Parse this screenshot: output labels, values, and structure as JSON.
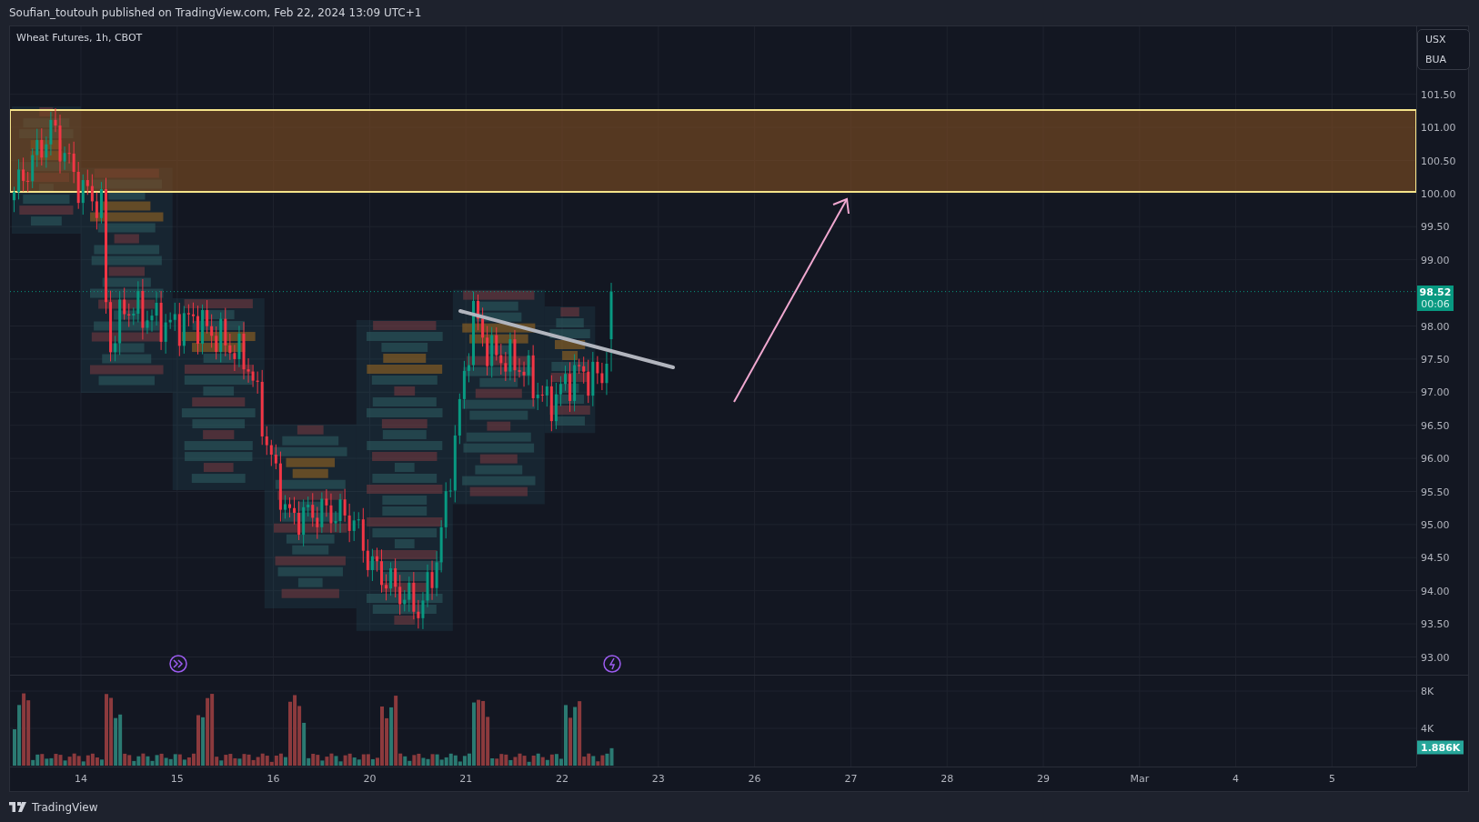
{
  "header": {
    "publisher_line": "Soufian_toutouh published on TradingView.com, Feb 22, 2024 13:09 UTC+1"
  },
  "chart": {
    "title": "Wheat Futures, 1h, CBOT",
    "currency_units": [
      "USX",
      "BUA"
    ],
    "price_axis": [
      "101.50",
      "101.00",
      "100.50",
      "100.00",
      "99.50",
      "99.00",
      "98.00",
      "97.50",
      "97.00",
      "96.50",
      "96.00",
      "95.50",
      "95.00",
      "94.50",
      "94.00",
      "93.50",
      "93.00"
    ],
    "last_price": {
      "price": "98.52",
      "countdown": "00:06"
    },
    "volume_axis": [
      "8K",
      "4K"
    ],
    "last_volume": "1.886K",
    "time_axis": [
      "14",
      "15",
      "16",
      "20",
      "21",
      "22",
      "23",
      "26",
      "27",
      "28",
      "29",
      "Mar",
      "4",
      "5"
    ]
  },
  "footer": {
    "brand": "TradingView"
  }
}
